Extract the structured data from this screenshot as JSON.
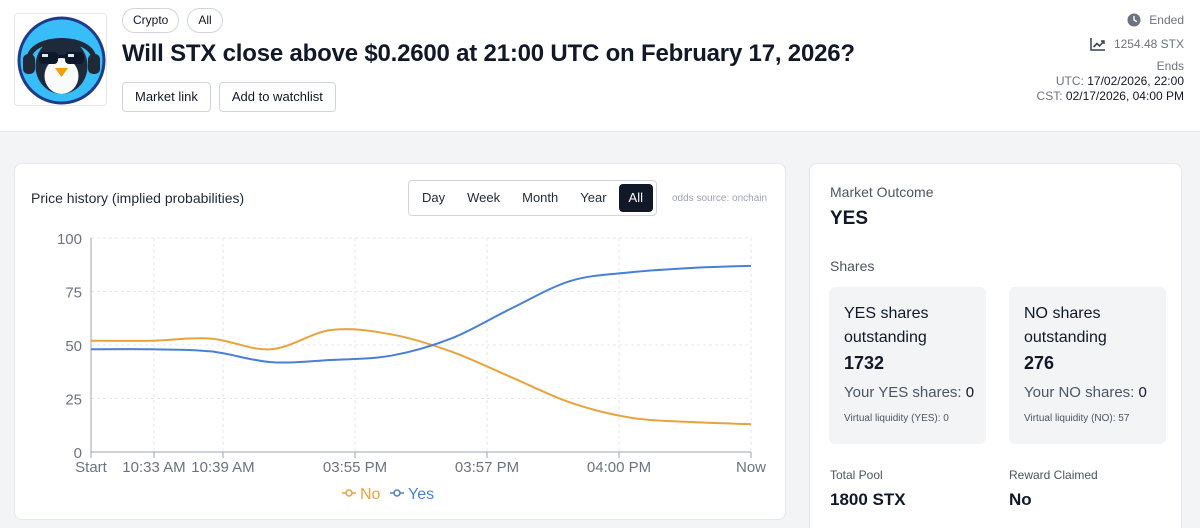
{
  "header": {
    "tags": [
      "Crypto",
      "All"
    ],
    "title": "Will STX close above $0.2600 at 21:00 UTC on February 17, 2026?",
    "actions": {
      "market_link": "Market link",
      "watchlist": "Add to watchlist"
    },
    "status": "Ended",
    "volume": "1254.48 STX",
    "ends_label": "Ends",
    "utc_label": "UTC:",
    "utc_value": "17/02/2026, 22:00",
    "cst_label": "CST:",
    "cst_value": "02/17/2026, 04:00 PM"
  },
  "chart_card": {
    "title": "Price history (implied probabilities)",
    "ranges": [
      "Day",
      "Week",
      "Month",
      "Year",
      "All"
    ],
    "active_range": "All",
    "odds_source": "odds source: onchain"
  },
  "chart_data": {
    "type": "line",
    "title": "Price history (implied probabilities)",
    "x_ticks": [
      "Start",
      "10:33 AM",
      "10:39 AM",
      "03:55 PM",
      "03:57 PM",
      "04:00 PM",
      "Now"
    ],
    "ylim": [
      0,
      100
    ],
    "y_ticks": [
      0,
      25,
      50,
      75,
      100
    ],
    "grid": true,
    "legend_position": "bottom",
    "series": [
      {
        "name": "No",
        "color": "#e8a33d",
        "points": [
          [
            0,
            52
          ],
          [
            1,
            52
          ],
          [
            2,
            53
          ],
          [
            3,
            48
          ],
          [
            4,
            57
          ],
          [
            5,
            55
          ],
          [
            6,
            47
          ],
          [
            7,
            35
          ],
          [
            8,
            23
          ],
          [
            9,
            16
          ],
          [
            10,
            14
          ],
          [
            11,
            13
          ]
        ]
      },
      {
        "name": "Yes",
        "color": "#4a7fd6",
        "points": [
          [
            0,
            48
          ],
          [
            1,
            48
          ],
          [
            2,
            47
          ],
          [
            3,
            42
          ],
          [
            4,
            43
          ],
          [
            5,
            45
          ],
          [
            6,
            53
          ],
          [
            7,
            67
          ],
          [
            8,
            80
          ],
          [
            9,
            84
          ],
          [
            10,
            86
          ],
          [
            11,
            87
          ]
        ]
      }
    ]
  },
  "outcome": {
    "market_outcome_label": "Market Outcome",
    "market_outcome_value": "YES",
    "shares_label": "Shares",
    "yes": {
      "title": "YES shares outstanding",
      "count": "1732",
      "your_label": "Your YES shares:",
      "your_value": "0",
      "virtual": "Virtual liquidity (YES): 0"
    },
    "no": {
      "title": "NO shares outstanding",
      "count": "276",
      "your_label": "Your NO shares:",
      "your_value": "0",
      "virtual": "Virtual liquidity (NO): 57"
    },
    "total_pool_label": "Total Pool",
    "total_pool_value": "1800 STX",
    "reward_claimed_label": "Reward Claimed",
    "reward_claimed_value": "No"
  }
}
